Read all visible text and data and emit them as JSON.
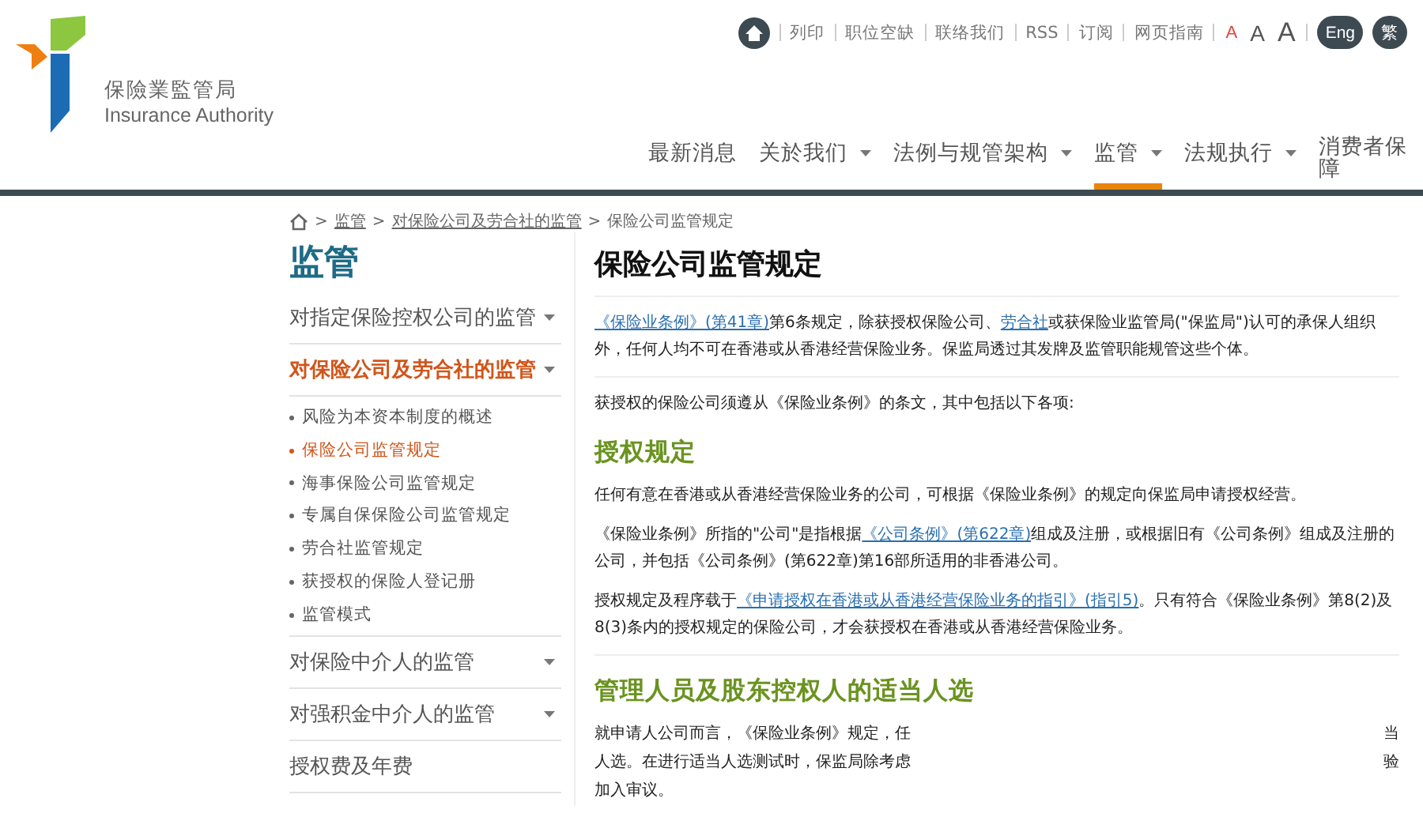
{
  "logo": {
    "chinese": "保險業監管局",
    "english": "Insurance Authority"
  },
  "utility_links": [
    "列印",
    "职位空缺",
    "联络我们",
    "RSS",
    "订阅",
    "网页指南"
  ],
  "font_sizes": [
    {
      "label": "A",
      "selected": true
    },
    {
      "label": "A",
      "selected": false
    },
    {
      "label": "A",
      "selected": false
    }
  ],
  "languages": [
    "Eng",
    "繁"
  ],
  "nav": [
    {
      "label": "最新消息",
      "dropdown": false,
      "selected": false
    },
    {
      "label": "关於我们",
      "dropdown": true,
      "selected": false
    },
    {
      "label": "法例与规管架构",
      "dropdown": true,
      "selected": false
    },
    {
      "label": "监管",
      "dropdown": true,
      "selected": true
    },
    {
      "label": "法规执行",
      "dropdown": true,
      "selected": false
    },
    {
      "label": "消费者保障",
      "dropdown": false,
      "selected": false
    }
  ],
  "breadcrumb": {
    "separator": ">",
    "items": [
      "监管",
      "对保险公司及劳合社的监管",
      "保险公司监管规定"
    ]
  },
  "sidebar": {
    "title": "监管",
    "items": [
      {
        "label": "对指定保险控权公司的监管",
        "dropdown": true,
        "selected": false
      },
      {
        "label": "对保险公司及劳合社的监管",
        "dropdown": true,
        "selected": true,
        "children": [
          {
            "label": "风险为本资本制度的概述",
            "selected": false
          },
          {
            "label": "保险公司监管规定",
            "selected": true
          },
          {
            "label": "海事保险公司监管规定",
            "selected": false
          },
          {
            "label": "专属自保保险公司监管规定",
            "selected": false
          },
          {
            "label": "劳合社监管规定",
            "selected": false
          },
          {
            "label": "获授权的保险人登记册",
            "selected": false
          },
          {
            "label": "监管模式",
            "selected": false
          }
        ]
      },
      {
        "label": "对保险中介人的监管",
        "dropdown": true,
        "selected": false
      },
      {
        "label": "对强积金中介人的监管",
        "dropdown": true,
        "selected": false
      },
      {
        "label": "授权费及年费",
        "dropdown": false,
        "selected": false
      }
    ]
  },
  "content": {
    "title": "保险公司监管规定",
    "blocks": [
      {
        "kind": "paragraph",
        "segments": [
          {
            "text": "《保险业条例》(第41章)",
            "link": true
          },
          {
            "text": "第6条规定，除获授权保险公司、",
            "link": false
          },
          {
            "text": "劳合社",
            "link": true
          },
          {
            "text": "或获保险业监管局(\"保监局\")认可的承保人组织外，任何人均不可在香港或从香港经营保险业务。保监局透过其发牌及监管职能规管这些个体。",
            "link": false
          }
        ]
      },
      {
        "kind": "divider"
      },
      {
        "kind": "paragraph",
        "segments": [
          {
            "text": "获授权的保险公司须遵从《保险业条例》的条文，其中包括以下各项:",
            "link": false
          }
        ]
      },
      {
        "kind": "heading",
        "text": "授权规定"
      },
      {
        "kind": "paragraph",
        "segments": [
          {
            "text": "任何有意在香港或从香港经营保险业务的公司，可根据《保险业条例》的规定向保监局申请授权经营。",
            "link": false
          }
        ]
      },
      {
        "kind": "paragraph",
        "segments": [
          {
            "text": "《保险业条例》所指的\"公司\"是指根据",
            "link": false
          },
          {
            "text": "《公司条例》(第622章)",
            "link": true
          },
          {
            "text": "组成及注册，或根据旧有《公司条例》组成及注册的公司，并包括《公司条例》(第622章)第16部所适用的非香港公司。",
            "link": false
          }
        ]
      },
      {
        "kind": "paragraph",
        "segments": [
          {
            "text": "授权规定及程序载于",
            "link": false
          },
          {
            "text": "《申请授权在香港或从香港经营保险业务的指引》(指引5)",
            "link": true
          },
          {
            "text": "。只有符合《保险业条例》第8(2)及8(3)条内的授权规定的保险公司，才会获授权在香港或从香港经营保险业务。",
            "link": false
          }
        ]
      },
      {
        "kind": "divider"
      },
      {
        "kind": "heading",
        "text": "管理人员及股东控权人的适当人选"
      },
      {
        "kind": "covered",
        "lines": [
          [
            "就申请人公司而言，《保险业条例》规定，任",
            "当"
          ],
          [
            "人选。在进行适当人选测试时，保监局除考虑",
            "验"
          ],
          [
            "加入审议。"
          ]
        ]
      }
    ]
  }
}
